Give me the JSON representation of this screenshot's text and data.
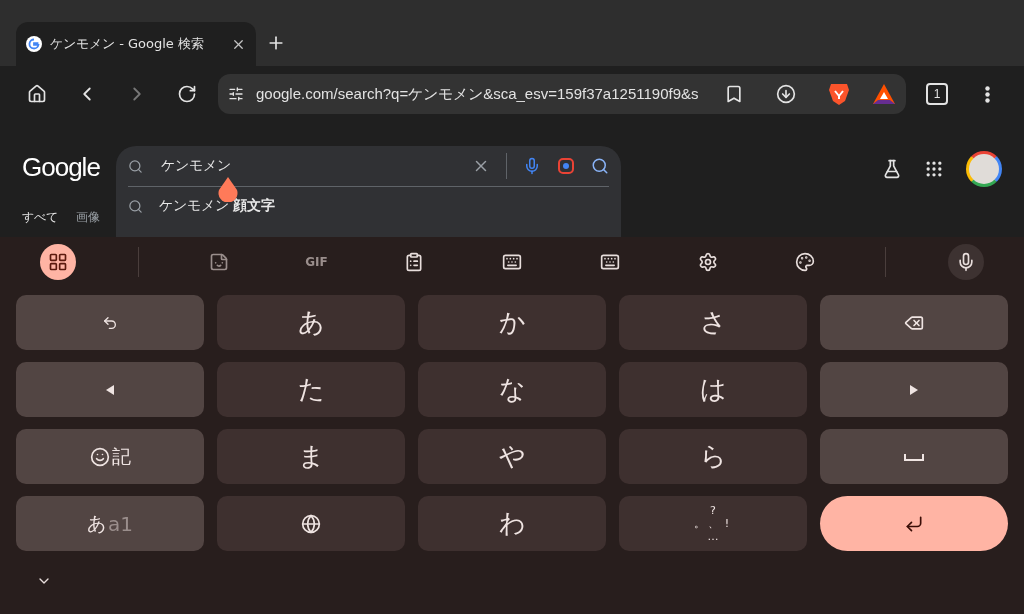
{
  "browser": {
    "tab": {
      "title": "ケンモメン - Google 検索"
    },
    "toolbar": {
      "forward_disabled": true,
      "url": "google.com/search?q=ケンモメン&sca_esv=159f37a1251190f9&s",
      "tab_count": "1"
    }
  },
  "page": {
    "logo": "Google",
    "search": {
      "value": "ケンモメン"
    },
    "suggestions": [
      "ケンモメン **顔文字**"
    ],
    "nav": [
      {
        "label": "すべて",
        "selected": true
      },
      {
        "label": "画像",
        "selected": false
      }
    ]
  },
  "keyboard": {
    "toolbar": [
      {
        "kind": "apps",
        "selected": true
      },
      {
        "kind": "sticker",
        "selected": false
      },
      {
        "kind": "gif",
        "label": "GIF",
        "selected": false
      },
      {
        "kind": "clipboard",
        "selected": false
      },
      {
        "kind": "keyboard-small",
        "selected": false
      },
      {
        "kind": "keyboard",
        "selected": false
      },
      {
        "kind": "settings",
        "selected": false
      },
      {
        "kind": "palette",
        "selected": false
      },
      {
        "kind": "mic",
        "selected": false
      }
    ],
    "rows": [
      [
        {
          "kind": "undo"
        },
        {
          "kind": "text",
          "label": "あ"
        },
        {
          "kind": "text",
          "label": "か"
        },
        {
          "kind": "text",
          "label": "さ"
        },
        {
          "kind": "backspace"
        }
      ],
      [
        {
          "kind": "left"
        },
        {
          "kind": "text",
          "label": "た"
        },
        {
          "kind": "text",
          "label": "な"
        },
        {
          "kind": "text",
          "label": "は"
        },
        {
          "kind": "right"
        }
      ],
      [
        {
          "kind": "emoji",
          "label": "記"
        },
        {
          "kind": "text",
          "label": "ま"
        },
        {
          "kind": "text",
          "label": "や"
        },
        {
          "kind": "text",
          "label": "ら"
        },
        {
          "kind": "space"
        }
      ],
      [
        {
          "kind": "mode",
          "label": "あ",
          "sub": "a1"
        },
        {
          "kind": "globe"
        },
        {
          "kind": "text",
          "label": "わ"
        },
        {
          "kind": "punct",
          "top": "?",
          "left": "。",
          "middle": "、",
          "right": "!",
          "bottom": "…"
        },
        {
          "kind": "enter"
        }
      ]
    ]
  }
}
